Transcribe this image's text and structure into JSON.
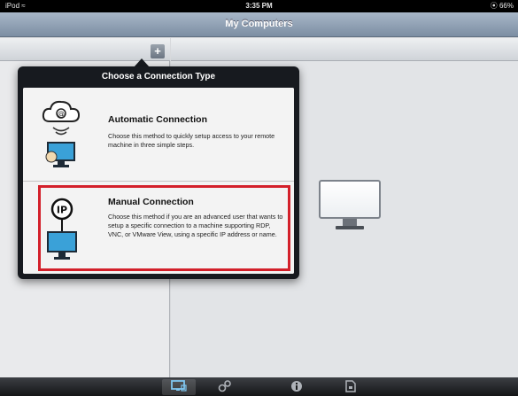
{
  "status_bar": {
    "carrier": "iPod ≈",
    "time": "3:35 PM",
    "battery": "⦿ 66%"
  },
  "nav_bar": {
    "title": "My Computers"
  },
  "toolbar": {
    "add_label": "+"
  },
  "popover": {
    "title": "Choose a Connection Type",
    "options": [
      {
        "icon": "cloud-computer-icon",
        "heading": "Automatic Connection",
        "description": "Choose this method to quickly setup access to your remote machine in three simple steps."
      },
      {
        "icon": "ip-computer-icon",
        "heading": "Manual Connection",
        "description": "Choose this method if you are an advanced user that wants to setup a specific connection to a machine supporting RDP, VNC, or VMware View, using a specific IP address or name.",
        "highlighted": true
      }
    ]
  },
  "tab_bar": {
    "tabs": [
      {
        "icon": "computers-icon",
        "selected": true
      },
      {
        "icon": "connections-icon",
        "selected": false
      },
      {
        "icon": "info-icon",
        "selected": false
      },
      {
        "icon": "document-icon",
        "selected": false
      }
    ]
  },
  "colors": {
    "highlight": "#d3202a",
    "nav_bar": "#8a9bb0",
    "popover": "#171a1f"
  }
}
